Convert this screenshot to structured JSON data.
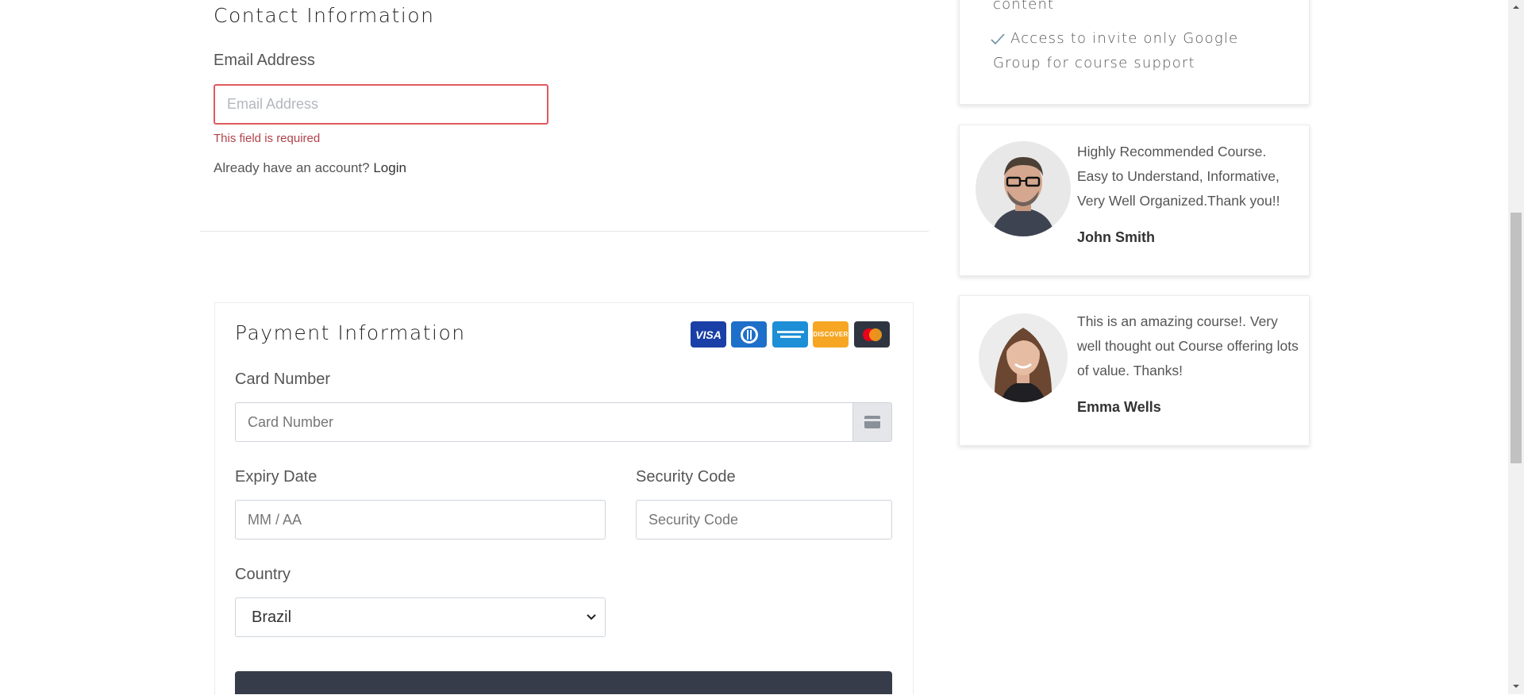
{
  "contact": {
    "title": "Contact Information",
    "email_label": "Email Address",
    "email_placeholder": "Email Address",
    "email_value": "",
    "error": "This field is required",
    "account_prompt": "Already have an account?",
    "login_link": "Login"
  },
  "payment": {
    "title": "Payment Information",
    "card_brands": [
      "VISA",
      "Diners Club",
      "American Express",
      "DISCOVER",
      "Mastercard"
    ],
    "card_number_label": "Card Number",
    "card_number_placeholder": "Card Number",
    "expiry_label": "Expiry Date",
    "expiry_placeholder": "MM / AA",
    "security_label": "Security Code",
    "security_placeholder": "Security Code",
    "country_label": "Country",
    "country_value": "Brazil"
  },
  "features": {
    "partial_line": "content",
    "item_line1": "Access to invite only Google",
    "item_line2": "Group for course support"
  },
  "reviews": [
    {
      "text": "Highly Recommended Course. Easy to Understand, Informative, Very Well Organized.Thank you!!",
      "name": "John Smith"
    },
    {
      "text": "This is an amazing course!. Very well thought out Course offering lots of value. Thanks!",
      "name": "Emma Wells"
    }
  ],
  "colors": {
    "error": "#e05a5e",
    "submit_bar": "#363c49",
    "visa": "#1a3fa6",
    "diners": "#1d6fc9",
    "amex": "#1d8fd6",
    "discover": "#f6a623",
    "mastercard": "#2f3540"
  }
}
